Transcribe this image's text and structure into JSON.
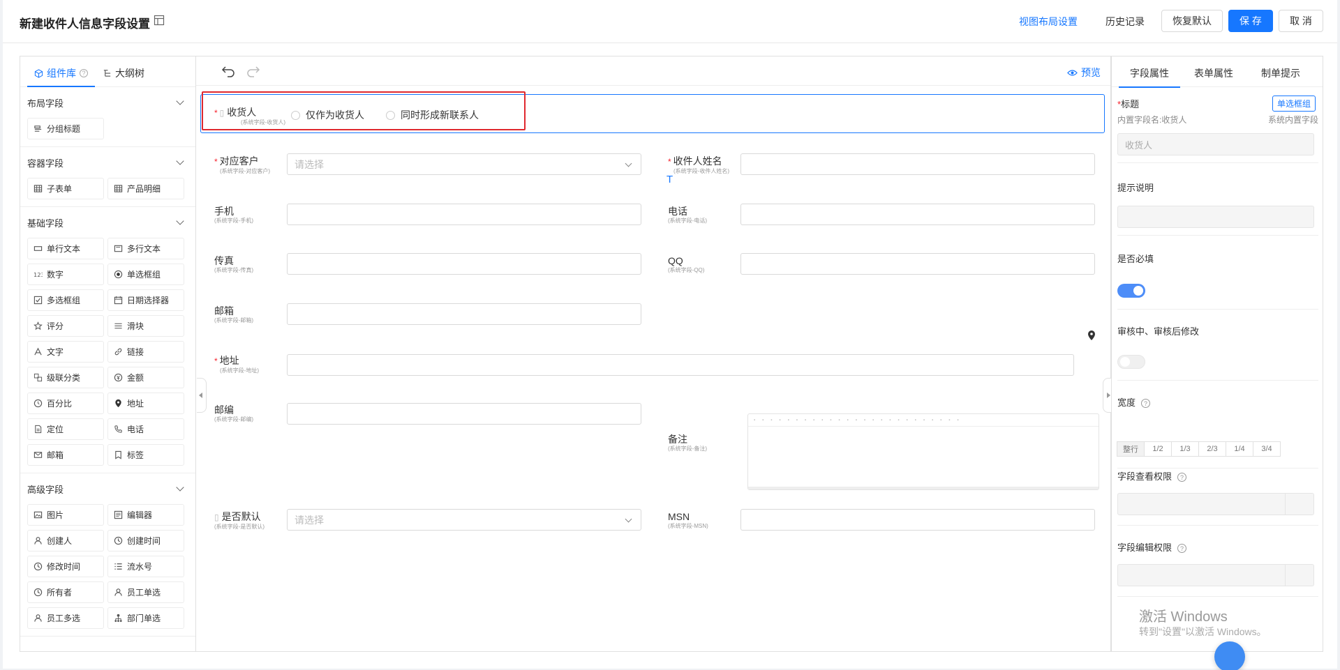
{
  "header": {
    "title": "新建收件人信息字段设置",
    "view_layout_link": "视图布局设置",
    "history_label": "历史记录",
    "restore_label": "恢复默认",
    "save_label": "保 存",
    "cancel_label": "取 消"
  },
  "left_panel": {
    "tab_library": "组件库",
    "tab_outline": "大纲树",
    "groups": [
      {
        "title": "布局字段",
        "items": [
          {
            "label": "分组标题",
            "icon": "group-title-icon"
          }
        ]
      },
      {
        "title": "容器字段",
        "items": [
          {
            "label": "子表单",
            "icon": "table-icon"
          },
          {
            "label": "产品明细",
            "icon": "table-icon"
          }
        ]
      },
      {
        "title": "基础字段",
        "items": [
          {
            "label": "单行文本",
            "icon": "single-line-icon"
          },
          {
            "label": "多行文本",
            "icon": "multi-line-icon"
          },
          {
            "label": "数字",
            "icon": "number-icon"
          },
          {
            "label": "单选框组",
            "icon": "radio-icon"
          },
          {
            "label": "多选框组",
            "icon": "checkbox-icon"
          },
          {
            "label": "日期选择器",
            "icon": "calendar-icon"
          },
          {
            "label": "评分",
            "icon": "star-icon"
          },
          {
            "label": "滑块",
            "icon": "slider-icon"
          },
          {
            "label": "文字",
            "icon": "text-icon"
          },
          {
            "label": "链接",
            "icon": "link-icon"
          },
          {
            "label": "级联分类",
            "icon": "cascade-icon"
          },
          {
            "label": "金额",
            "icon": "money-icon"
          },
          {
            "label": "百分比",
            "icon": "percent-icon"
          },
          {
            "label": "地址",
            "icon": "location-icon"
          },
          {
            "label": "定位",
            "icon": "locate-icon"
          },
          {
            "label": "电话",
            "icon": "phone-icon"
          },
          {
            "label": "邮箱",
            "icon": "mail-icon"
          },
          {
            "label": "标签",
            "icon": "tag-icon"
          }
        ]
      },
      {
        "title": "高级字段",
        "items": [
          {
            "label": "图片",
            "icon": "image-icon"
          },
          {
            "label": "编辑器",
            "icon": "editor-icon"
          },
          {
            "label": "创建人",
            "icon": "user-icon"
          },
          {
            "label": "创建时间",
            "icon": "clock-icon"
          },
          {
            "label": "修改时间",
            "icon": "clock-icon"
          },
          {
            "label": "流水号",
            "icon": "list-number-icon"
          },
          {
            "label": "所有者",
            "icon": "clock-icon"
          },
          {
            "label": "员工单选",
            "icon": "user-icon"
          },
          {
            "label": "员工多选",
            "icon": "user-icon"
          },
          {
            "label": "部门单选",
            "icon": "org-icon"
          }
        ]
      }
    ]
  },
  "canvas": {
    "preview_label": "预览",
    "receiver": {
      "label": "收货人",
      "sub": "(系统字段-收货人)",
      "opt1": "仅作为收货人",
      "opt2": "同时形成新联系人"
    },
    "customer": {
      "label": "对应客户",
      "sub": "(系统字段-对应客户)",
      "placeholder": "请选择"
    },
    "recipient_name": {
      "label": "收件人姓名",
      "sub": "(系统字段-收件人姓名)"
    },
    "mobile": {
      "label": "手机",
      "sub": "(系统字段-手机)"
    },
    "phone": {
      "label": "电话",
      "sub": "(系统字段-电话)"
    },
    "fax": {
      "label": "传真",
      "sub": "(系统字段-传真)"
    },
    "qq": {
      "label": "QQ",
      "sub": "(系统字段-QQ)"
    },
    "email": {
      "label": "邮箱",
      "sub": "(系统字段-邮箱)"
    },
    "address": {
      "label": "地址",
      "sub": "(系统字段-地址)"
    },
    "zip": {
      "label": "邮编",
      "sub": "(系统字段-邮编)"
    },
    "remark": {
      "label": "备注",
      "sub": "(系统字段-备注)"
    },
    "is_default": {
      "label": "是否默认",
      "sub": "(系统字段-是否默认)",
      "placeholder": "请选择"
    },
    "msn": {
      "label": "MSN",
      "sub": "(系统字段-MSN)"
    }
  },
  "right_panel": {
    "tab_field": "字段属性",
    "tab_form": "表单属性",
    "tab_tips": "制单提示",
    "title_label": "标题",
    "title_badge": "单选框组",
    "builtin_name": "内置字段名:收货人",
    "builtin_note": "系统内置字段",
    "title_value": "收货人",
    "hint_label": "提示说明",
    "required_label": "是否必填",
    "audit_label": "审核中、审核后修改",
    "width_label": "宽度",
    "width_options": [
      "整行",
      "1/2",
      "1/3",
      "2/3",
      "1/4",
      "3/4"
    ],
    "view_perm_label": "字段查看权限",
    "edit_perm_label": "字段编辑权限"
  },
  "watermark": {
    "line1": "激活 Windows",
    "line2": "转到\"设置\"以激活 Windows。"
  }
}
